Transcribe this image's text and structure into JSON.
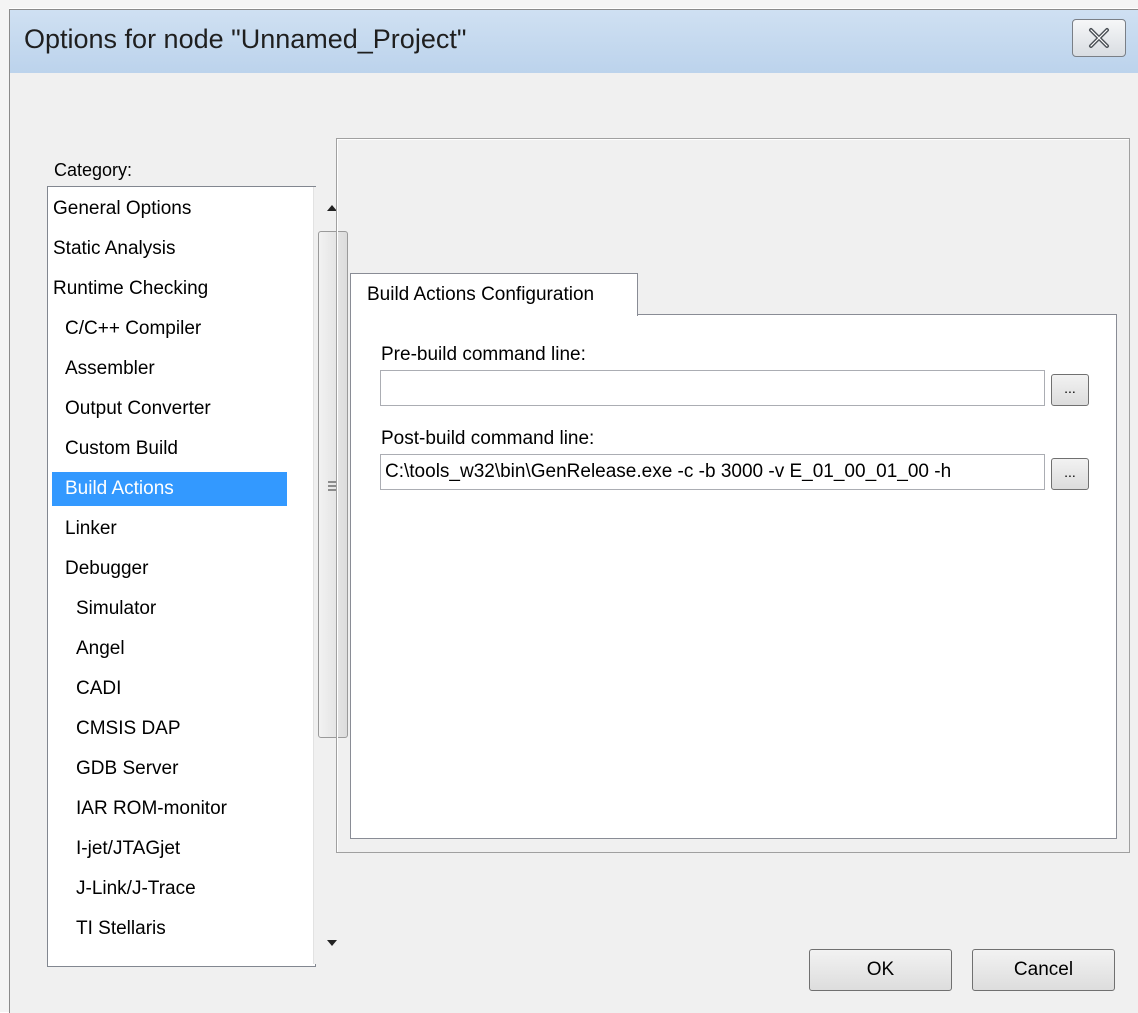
{
  "window": {
    "title": "Options for node \"Unnamed_Project\"",
    "close_icon": "close-icon"
  },
  "category": {
    "label": "Category:",
    "items": [
      {
        "label": "General Options",
        "indent": 0
      },
      {
        "label": "Static Analysis",
        "indent": 0
      },
      {
        "label": "Runtime Checking",
        "indent": 0
      },
      {
        "label": "C/C++ Compiler",
        "indent": 1
      },
      {
        "label": "Assembler",
        "indent": 1
      },
      {
        "label": "Output Converter",
        "indent": 1
      },
      {
        "label": "Custom Build",
        "indent": 1
      },
      {
        "label": "Build Actions",
        "indent": 1,
        "selected": true
      },
      {
        "label": "Linker",
        "indent": 1
      },
      {
        "label": "Debugger",
        "indent": 1
      },
      {
        "label": "Simulator",
        "indent": 2
      },
      {
        "label": "Angel",
        "indent": 2
      },
      {
        "label": "CADI",
        "indent": 2
      },
      {
        "label": "CMSIS DAP",
        "indent": 2
      },
      {
        "label": "GDB Server",
        "indent": 2
      },
      {
        "label": "IAR ROM-monitor",
        "indent": 2
      },
      {
        "label": "I-jet/JTAGjet",
        "indent": 2
      },
      {
        "label": "J-Link/J-Trace",
        "indent": 2
      },
      {
        "label": "TI Stellaris",
        "indent": 2
      }
    ],
    "selected_color": "#3399ff"
  },
  "tab": {
    "label": "Build Actions Configuration"
  },
  "pre_build": {
    "label": "Pre-build command line:",
    "value": "",
    "browse_label": "..."
  },
  "post_build": {
    "label": "Post-build command line:",
    "value": "C:\\tools_w32\\bin\\GenRelease.exe -c -b 3000 -v E_01_00_01_00 -h",
    "browse_label": "..."
  },
  "buttons": {
    "ok": "OK",
    "cancel": "Cancel"
  }
}
